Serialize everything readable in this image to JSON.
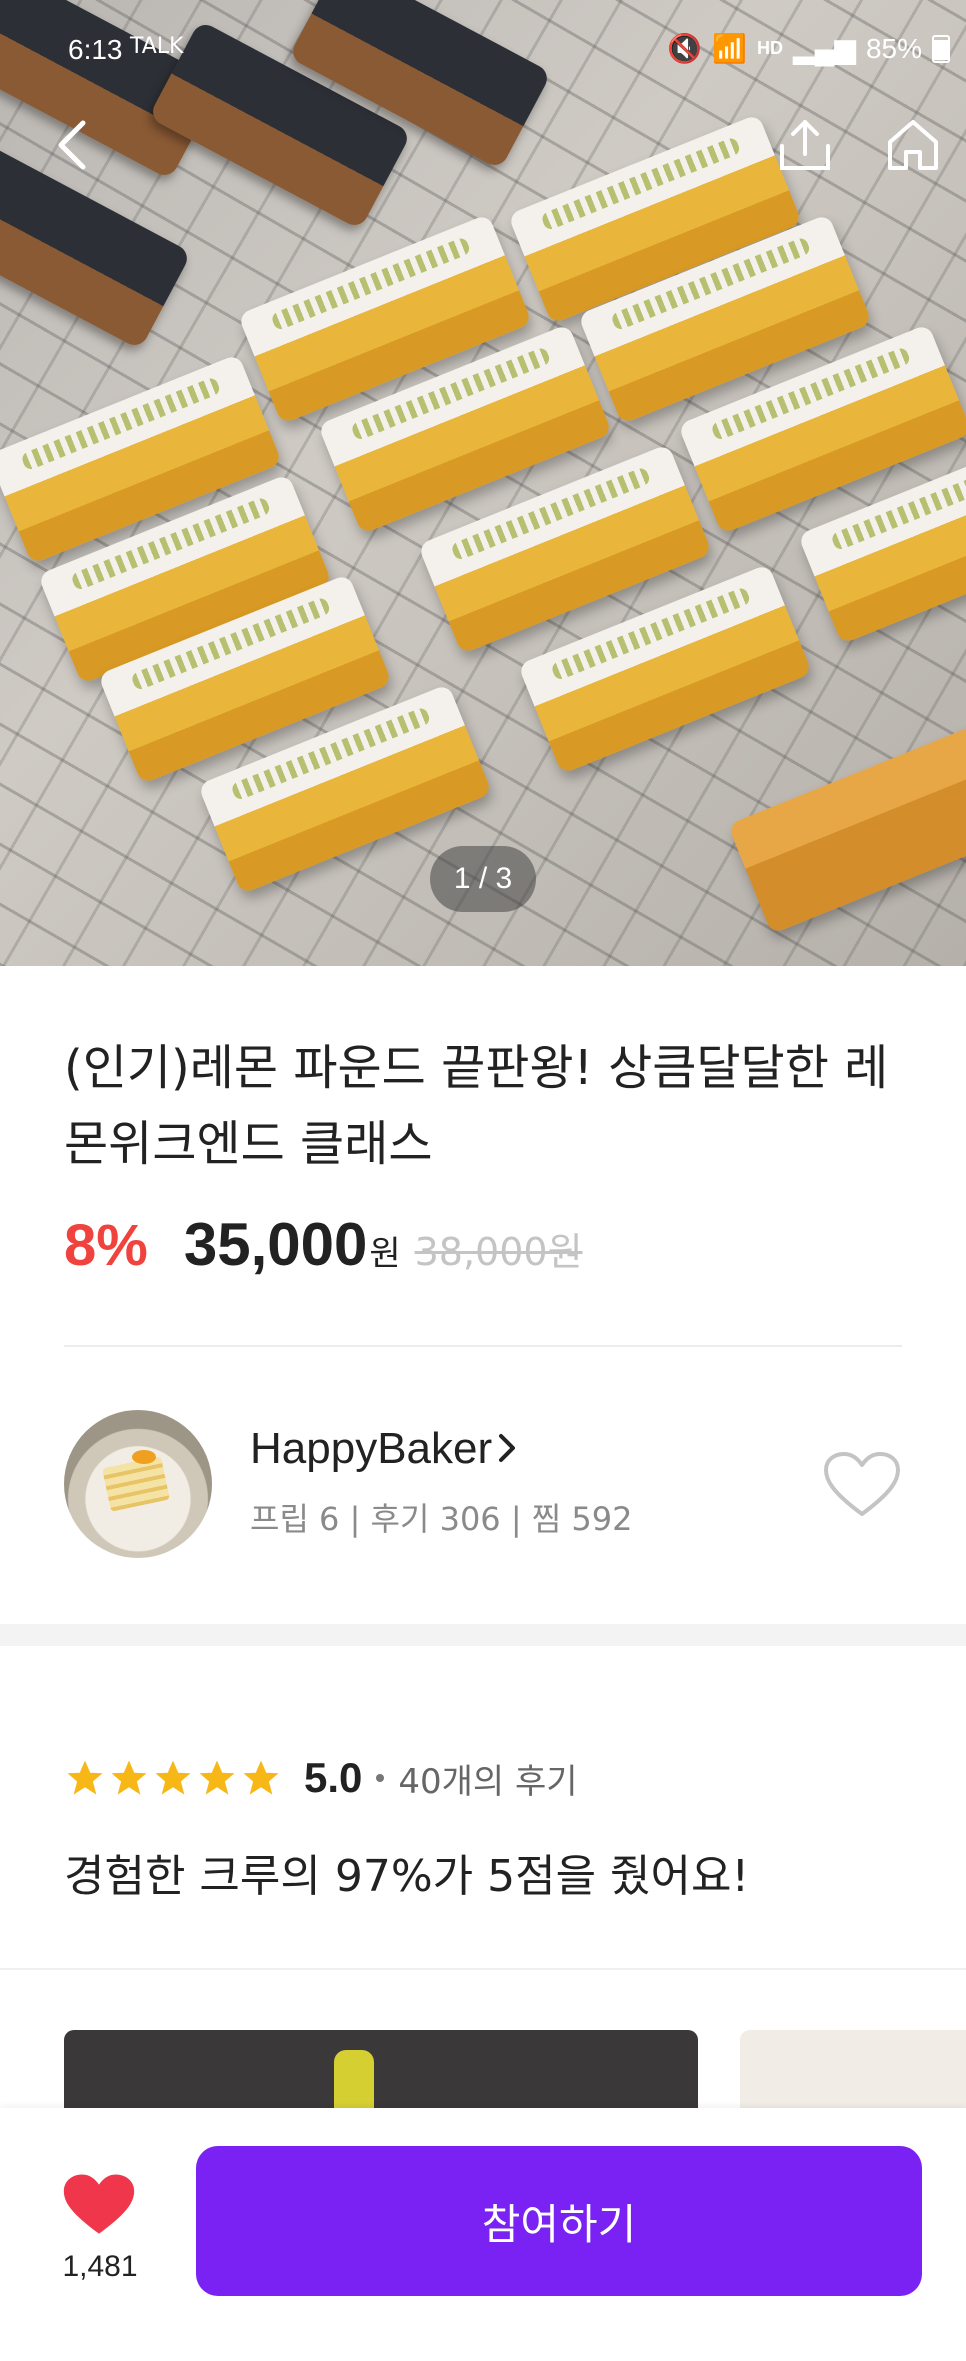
{
  "status_bar": {
    "time": "6:13",
    "app_icons": "TALK",
    "network": "HD",
    "battery": "85%"
  },
  "header": {
    "back_icon": "back-arrow-icon",
    "share_icon": "share-icon",
    "home_icon": "home-icon"
  },
  "gallery": {
    "indicator": "1 / 3"
  },
  "product": {
    "title": "(인기)레몬 파운드 끝판왕! 상큼달달한 레몬위크엔드 클래스",
    "discount": "8%",
    "price": "35,000",
    "price_unit": "원",
    "original_price": "38,000원"
  },
  "host": {
    "name": "HappyBaker",
    "stats": "프립 6 | 후기 306 | 찜 592",
    "heart_icon": "heart-outline-icon"
  },
  "rating": {
    "stars": 5,
    "score": "5.0",
    "review_count": "40개의 후기",
    "summary": "경험한 크루의 97%가 5점을 줬어요!",
    "star_color": "#f7b817"
  },
  "bottom_bar": {
    "like_count": "1,481",
    "like_color": "#f0364b",
    "join_label": "참여하기",
    "join_color": "#7a22f3"
  }
}
